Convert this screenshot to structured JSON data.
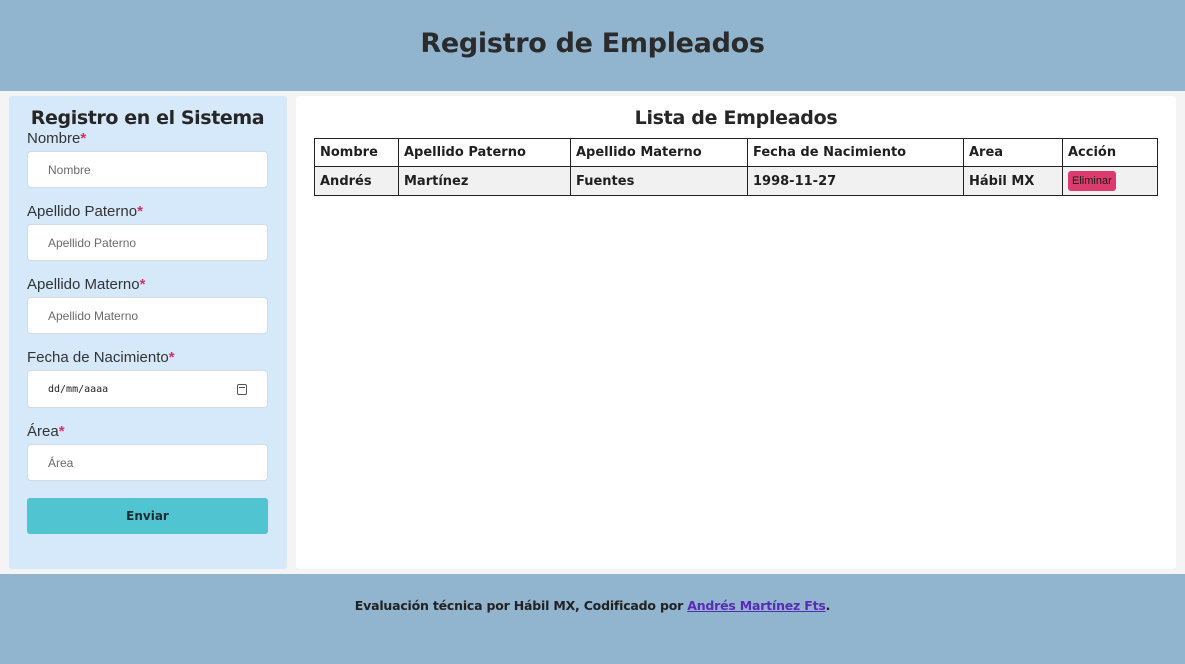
{
  "header": {
    "title": "Registro de Empleados"
  },
  "form": {
    "title": "Registro en el Sistema",
    "required_mark": "*",
    "fields": [
      {
        "label": "Nombre",
        "placeholder": "Nombre",
        "value": ""
      },
      {
        "label": "Apellido Paterno",
        "placeholder": "Apellido Paterno",
        "value": ""
      },
      {
        "label": "Apellido Materno",
        "placeholder": "Apellido Materno",
        "value": ""
      },
      {
        "label": "Fecha de Nacimiento",
        "placeholder": "dd/mm/aaaa",
        "value": "",
        "icon": "calendar-icon"
      },
      {
        "label": "Área",
        "placeholder": "Área",
        "value": ""
      }
    ],
    "submit_label": "Enviar"
  },
  "list": {
    "title": "Lista de Empleados",
    "columns": [
      "Nombre",
      "Apellido Paterno",
      "Apellido Materno",
      "Fecha de Nacimiento",
      "Area",
      "Acción"
    ],
    "rows": [
      {
        "nombre": "Andrés",
        "apellido_paterno": "Martínez",
        "apellido_materno": "Fuentes",
        "fecha": "1998-11-27",
        "area": "Hábil MX",
        "action_label": "Eliminar"
      }
    ]
  },
  "footer": {
    "text": "Evaluación técnica por Hábil MX, Codificado por ",
    "link_text": "Andrés Martínez Fts",
    "suffix": "."
  },
  "colors": {
    "header_bg": "#91b4cf",
    "form_bg": "#d6e9fa",
    "submit_bg": "#51c4d2",
    "delete_bg": "#dc3b6e",
    "required": "#d0306b",
    "link": "#5a2bb5"
  }
}
